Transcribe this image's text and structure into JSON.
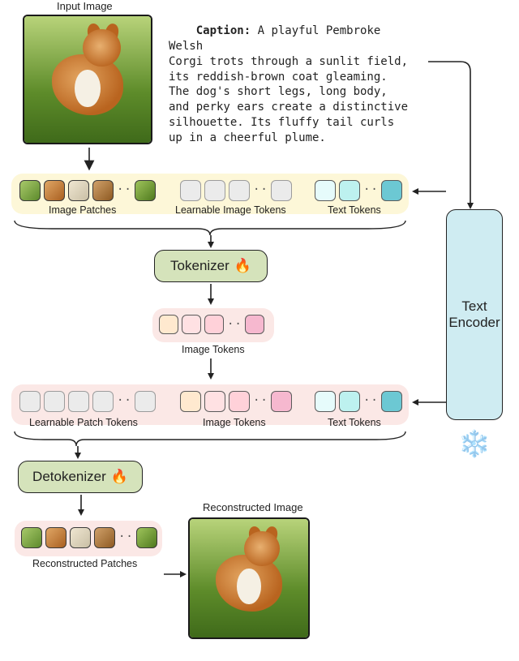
{
  "titles": {
    "input_image": "Input Image",
    "caption_label": "Caption:",
    "caption_text": "A playful Pembroke Welsh\nCorgi trots through a sunlit field,\nits reddish-brown coat gleaming.\nThe dog's short legs, long body,\nand perky ears create a distinctive\nsilhouette. Its fluffy tail curls\nup in a cheerful plume.",
    "reconstructed_image": "Reconstructed Image"
  },
  "groups": {
    "image_patches": "Image Patches",
    "learnable_image_tokens": "Learnable Image Tokens",
    "text_tokens": "Text Tokens",
    "image_tokens": "Image Tokens",
    "learnable_patch_tokens": "Learnable Patch Tokens",
    "image_tokens_2": "Image Tokens",
    "text_tokens_2": "Text Tokens",
    "reconstructed_patches": "Reconstructed Patches"
  },
  "blocks": {
    "tokenizer": "Tokenizer",
    "detokenizer": "Detokenizer",
    "text_encoder": "Text\nEncoder"
  },
  "icons": {
    "fire": "🔥",
    "snow": "❄️",
    "ellipsis": "···"
  }
}
